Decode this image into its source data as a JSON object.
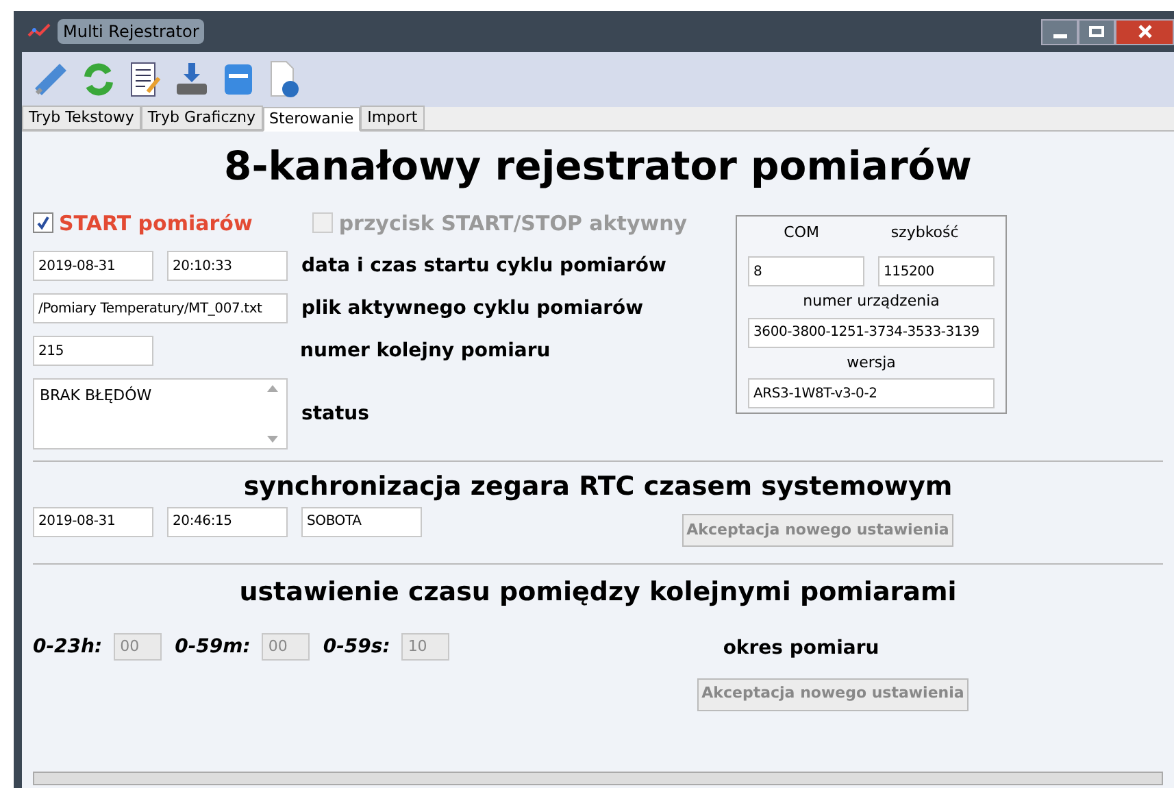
{
  "window": {
    "title": "Multi Rejestrator"
  },
  "tabs": [
    {
      "label": "Tryb Tekstowy",
      "selected": false
    },
    {
      "label": "Tryb Graficzny",
      "selected": false
    },
    {
      "label": "Sterowanie",
      "selected": true
    },
    {
      "label": "Import",
      "selected": false
    }
  ],
  "heading": "8-kanałowy rejestrator pomiarów",
  "start_checkbox": {
    "label": "START pomiarów",
    "checked": true,
    "disabled": false
  },
  "startstop_checkbox": {
    "label": "przycisk START/STOP aktywny",
    "checked": false,
    "disabled": true
  },
  "cycle": {
    "date": "2019-08-31",
    "time": "20:10:33",
    "datetime_label": "data i czas startu cyklu pomiarów",
    "file": "/Pomiary Temperatury/MT_007.txt",
    "file_label": "plik aktywnego cyklu pomiarów",
    "number": "215",
    "number_label": "numer kolejny pomiaru",
    "status": "BRAK BŁĘDÓW",
    "status_label": "status"
  },
  "device": {
    "com_label": "COM",
    "speed_label": "szybkość",
    "com": "8",
    "speed": "115200",
    "serial_label": "numer urządzenia",
    "serial": "3600-3800-1251-3734-3533-3139",
    "version_label": "wersja",
    "version": "ARS3-1W8T-v3-0-2"
  },
  "sync": {
    "heading": "synchronizacja zegara RTC czasem systemowym",
    "date": "2019-08-31",
    "time": "20:46:15",
    "day": "SOBOTA",
    "button": {
      "label": "Akceptacja nowego ustawienia",
      "disabled": true
    }
  },
  "interval": {
    "heading": "ustawienie czasu pomiędzy kolejnymi pomiarami",
    "fields": [
      {
        "label": "0-23h:",
        "value": "00",
        "disabled": true
      },
      {
        "label": "0-59m:",
        "value": "00",
        "disabled": true
      },
      {
        "label": "0-59s:",
        "value": "10",
        "disabled": true
      }
    ],
    "period_label": "okres pomiaru",
    "button": {
      "label": "Akceptacja nowego ustawienia",
      "disabled": true
    }
  }
}
